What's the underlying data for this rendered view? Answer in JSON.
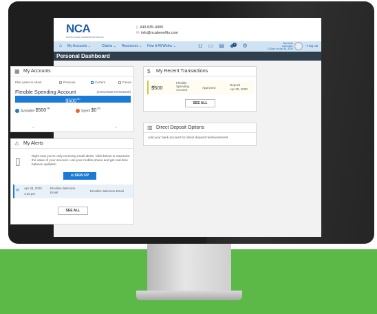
{
  "header": {
    "logo": "NCA",
    "logo_sub": "NORTH COAST ADMINISTRATORS INC.",
    "phone": "440-835-4900",
    "email": "info@ncabenefits.com"
  },
  "nav": {
    "items": [
      "My Accounts",
      "Claims",
      "Resources",
      "How It All Works"
    ],
    "notification_count": "9",
    "user_name": "Test User",
    "last_login_label": "Last login:",
    "last_login_value": "1:02pm on Apr 30, 2020",
    "logout": "log out"
  },
  "page": {
    "title": "Personal Dashboard"
  },
  "accounts": {
    "title": "My Accounts",
    "plan_years_label": "Plan years to show:",
    "options": [
      "Previous",
      "Current",
      "Future"
    ],
    "selected_option": "Current",
    "account_name": "Flexible Spending Account",
    "date_range": "(01/01/2020-07/31/2020)",
    "balance": "$500",
    "balance_cents": ".00",
    "available_label": "Available",
    "available_amount": "$500",
    "available_cents": ".00",
    "spent_label": "Spent",
    "spent_amount": "$0",
    "spent_cents": ".00",
    "colors": {
      "available": "#1a7ad6",
      "spent": "#e8672a"
    }
  },
  "alerts": {
    "title": "My Alerts",
    "message": "Right now you're only receiving email alerts. Click below to maximize the value of your account. Link your mobile phone and get real-time balance updates!",
    "signup_label": "SIGN UP",
    "row_date": "Apr 28, 2020",
    "row_time": "4:15 pm",
    "row_subject": "Enrollee Welcome Email",
    "row_type": "Enrollee Welcome Email",
    "see_all": "SEE ALL"
  },
  "transactions": {
    "title": "My Recent Transactions",
    "amount": "$500",
    "amount_cents": ".00",
    "description": "Flexible Spending Account",
    "status": "Approved",
    "type": "Deposit",
    "date": "Apr 28, 2020",
    "see_all": "SEE ALL"
  },
  "direct_deposit": {
    "title": "Direct Deposit Options",
    "text": "Add your bank account for direct deposit reimbursement"
  }
}
